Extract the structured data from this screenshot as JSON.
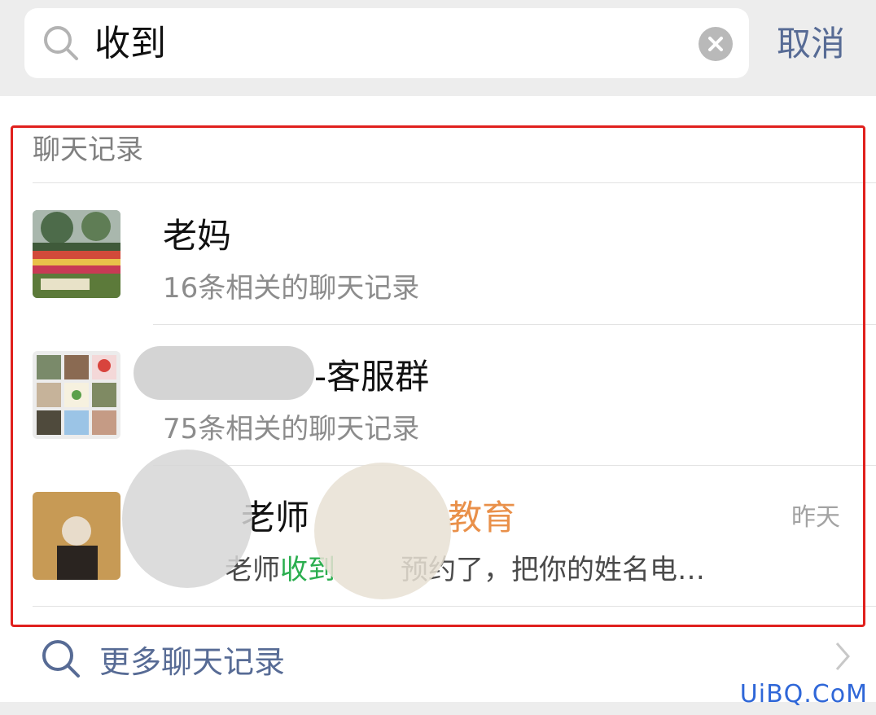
{
  "search": {
    "query": "收到",
    "cancel_label": "取消"
  },
  "section": {
    "title": "聊天记录"
  },
  "results": [
    {
      "title": "老妈",
      "subtitle": "16条相关的聊天记录"
    },
    {
      "title": "-客服群",
      "subtitle": "75条相关的聊天记录"
    },
    {
      "title_a": "老师",
      "title_b": "教育",
      "time": "昨天",
      "snippet_a": "老师",
      "snippet_highlight": "收到",
      "snippet_b": "预约了，把你的姓名电…"
    }
  ],
  "more": {
    "label": "更多聊天记录"
  },
  "watermark": "UiBQ.CoM",
  "colors": {
    "link": "#576b95",
    "highlight": "#2bae4f",
    "frame": "#e0201d"
  }
}
